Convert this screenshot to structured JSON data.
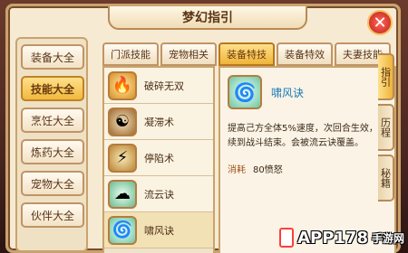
{
  "window": {
    "title": "梦幻指引"
  },
  "sidebar": {
    "items": [
      {
        "label": "装备大全",
        "active": false
      },
      {
        "label": "技能大全",
        "active": true
      },
      {
        "label": "烹饪大全",
        "active": false
      },
      {
        "label": "炼药大全",
        "active": false
      },
      {
        "label": "宠物大全",
        "active": false
      },
      {
        "label": "伙伴大全",
        "active": false
      }
    ]
  },
  "tabs": [
    {
      "label": "门派技能",
      "active": false
    },
    {
      "label": "宠物相关",
      "active": false
    },
    {
      "label": "装备特技",
      "active": true
    },
    {
      "label": "装备特效",
      "active": false
    },
    {
      "label": "夫妻技能",
      "active": false
    }
  ],
  "skills": [
    {
      "label": "破碎无双",
      "icon": "fire-icon"
    },
    {
      "label": "凝滞术",
      "icon": "slow-icon"
    },
    {
      "label": "停陷术",
      "icon": "trap-icon"
    },
    {
      "label": "流云诀",
      "icon": "cloud-icon"
    },
    {
      "label": "啸风诀",
      "icon": "wind-icon"
    }
  ],
  "detail": {
    "name": "啸风诀",
    "description": "提高己方全体5%速度，次回合生效，持续到战斗结束。会被流云诀覆盖。",
    "cost_label": "消耗",
    "cost_value": "80愤怒"
  },
  "vtabs": [
    "指引",
    "历程",
    "秘籍"
  ],
  "watermark": {
    "text": "APP178",
    "sub": "手游网"
  },
  "colors": {
    "accent": "#efb43a",
    "close": "#c01d17",
    "link": "#1a7ab8"
  }
}
